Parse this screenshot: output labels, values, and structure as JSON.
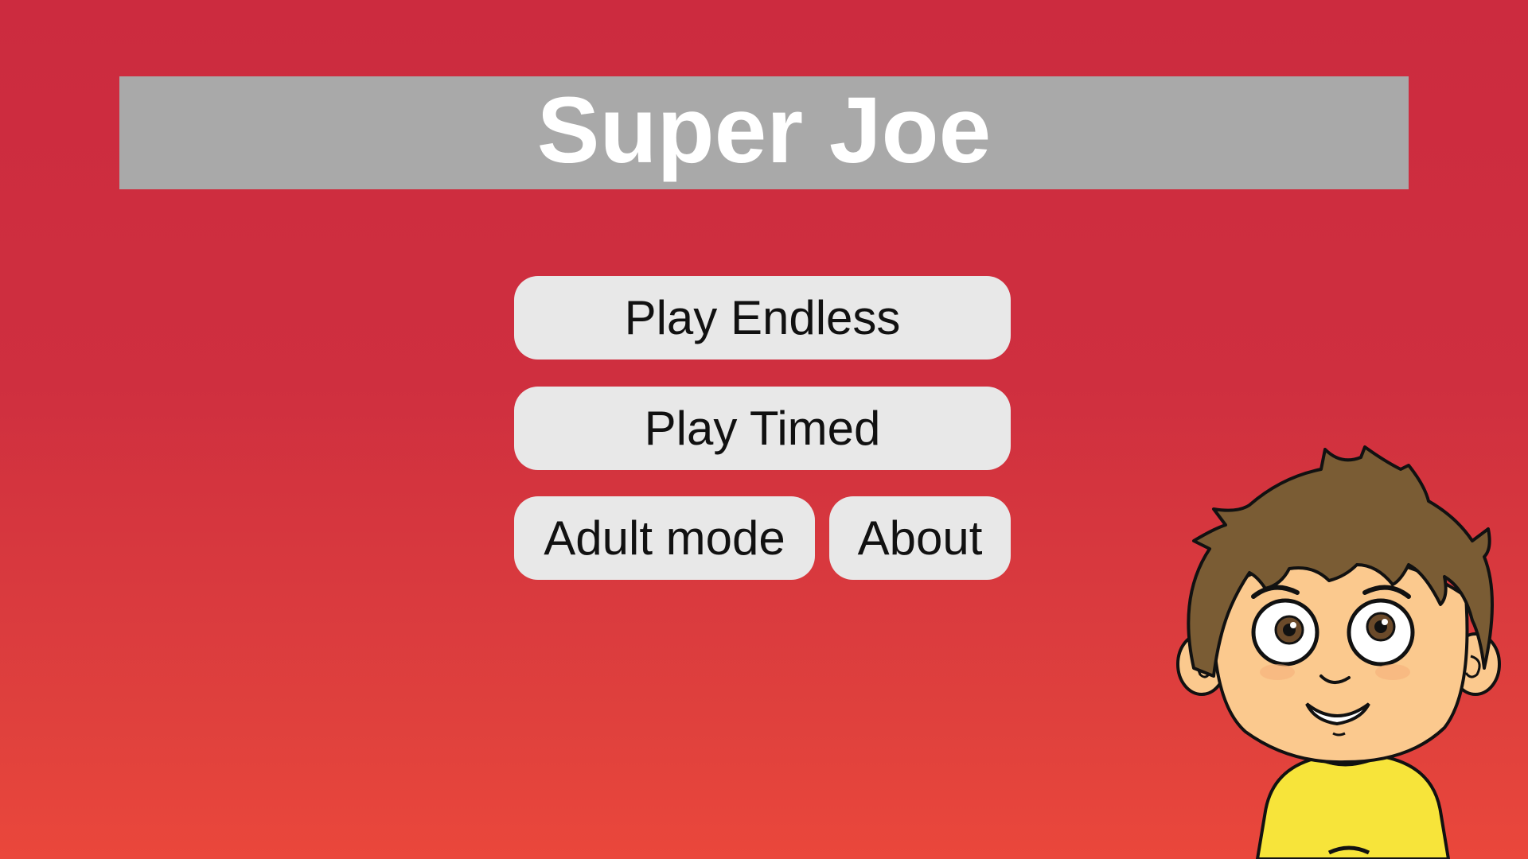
{
  "game": {
    "title": "Super Joe"
  },
  "menu": {
    "play_endless": "Play Endless",
    "play_timed": "Play Timed",
    "adult_mode": "Adult mode",
    "about": "About"
  },
  "colors": {
    "background_top": "#cc2b3f",
    "background_bottom": "#ea473b",
    "banner": "#a9a9a9",
    "button": "#e8e8e8",
    "button_text": "#111111",
    "title_text": "#ffffff",
    "hair": "#7a5c34",
    "skin": "#fbc98e",
    "shirt": "#f7e43a"
  },
  "mascot": {
    "icon": "boy-character-icon"
  }
}
